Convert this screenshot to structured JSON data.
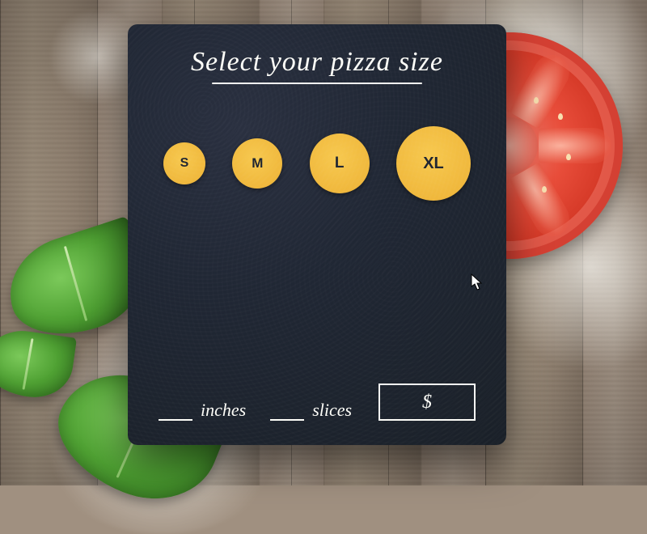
{
  "title": "Select your pizza size",
  "sizes": {
    "s": "S",
    "m": "M",
    "l": "L",
    "xl": "XL"
  },
  "footer": {
    "inches_label": "inches",
    "slices_label": "slices",
    "price_prefix": "$"
  },
  "colors": {
    "card_bg": "#202734",
    "accent": "#f0b83c",
    "text": "#fdfdf8"
  }
}
